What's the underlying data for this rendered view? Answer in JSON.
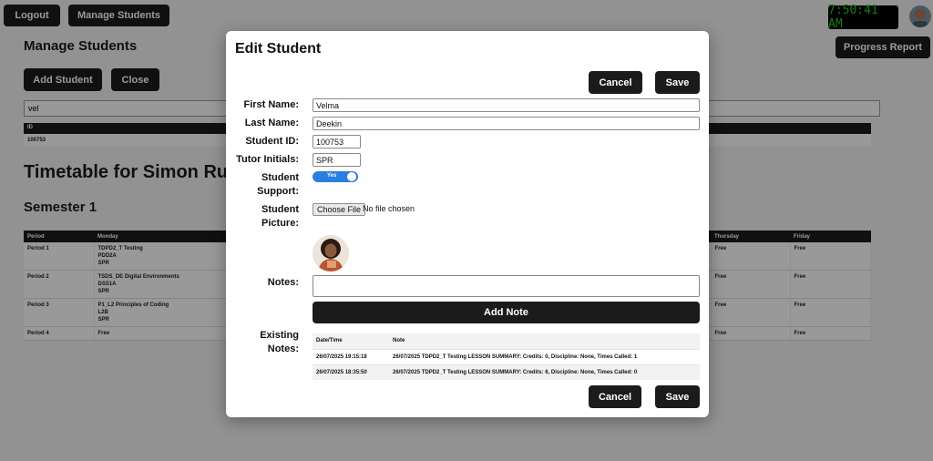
{
  "topbar": {
    "logout": "Logout",
    "manage_students": "Manage Students",
    "clock": "7:50:41 AM",
    "progress_report": "Progress Report"
  },
  "manage": {
    "title": "Manage Students",
    "add_student": "Add Student",
    "close": "Close",
    "search_value": "vel",
    "table_header_id": "ID",
    "table_row_id": "100753"
  },
  "timetable": {
    "title": "Timetable for Simon Ru",
    "semester": "Semester 1",
    "headers": {
      "period": "Period",
      "monday": "Monday",
      "thursday": "Thursday",
      "friday": "Friday"
    },
    "rows": [
      {
        "period": "Period 1",
        "monday": [
          "TDPD2_T Testing",
          "PDD2A",
          "SPR"
        ],
        "thursday": "Free",
        "friday": "Free"
      },
      {
        "period": "Period 2",
        "monday": [
          "TSDS_DE Digital Environments",
          "DSS1A",
          "SPR"
        ],
        "thursday": "Free",
        "friday": "Free"
      },
      {
        "period": "Period 3",
        "monday": [
          "P1_L2 Principles of Coding",
          "L2B",
          "SPR"
        ],
        "thursday": "Free",
        "friday": "Free"
      },
      {
        "period": "Period 4",
        "monday": [
          "Free"
        ],
        "thursday": "Free",
        "friday": "Free"
      }
    ]
  },
  "modal": {
    "title": "Edit Student",
    "cancel": "Cancel",
    "save": "Save",
    "labels": {
      "first_name": "First Name:",
      "last_name": "Last Name:",
      "student_id": "Student ID:",
      "tutor_initials": "Tutor Initials:",
      "student_support_1": "Student",
      "student_support_2": "Support:",
      "student_picture_1": "Student",
      "student_picture_2": "Picture:",
      "notes": "Notes:",
      "existing_notes_1": "Existing",
      "existing_notes_2": "Notes:"
    },
    "values": {
      "first_name": "Velma",
      "last_name": "Deekin",
      "student_id": "100753",
      "tutor_initials": "SPR",
      "support_toggle": "Yes",
      "notes": ""
    },
    "file": {
      "button": "Choose File",
      "status": "No file chosen"
    },
    "add_note": "Add Note",
    "notes_table": {
      "headers": {
        "datetime": "Date/Time",
        "note": "Note"
      },
      "rows": [
        {
          "datetime": "26/07/2025 19:15:18",
          "note": "26/07/2025 TDPD2_T Testing LESSON SUMMARY: Credits: 0, Discipline: None, Times Called: 1"
        },
        {
          "datetime": "26/07/2025 18:35:50",
          "note": "26/07/2025 TDPD2_T Testing LESSON SUMMARY: Credits: 6, Discipline: None, Times Called: 0"
        }
      ]
    }
  },
  "colors": {
    "accent_toggle": "#2a7de1",
    "clock_text": "#1ed31e",
    "dark_button": "#1b1b1b"
  }
}
